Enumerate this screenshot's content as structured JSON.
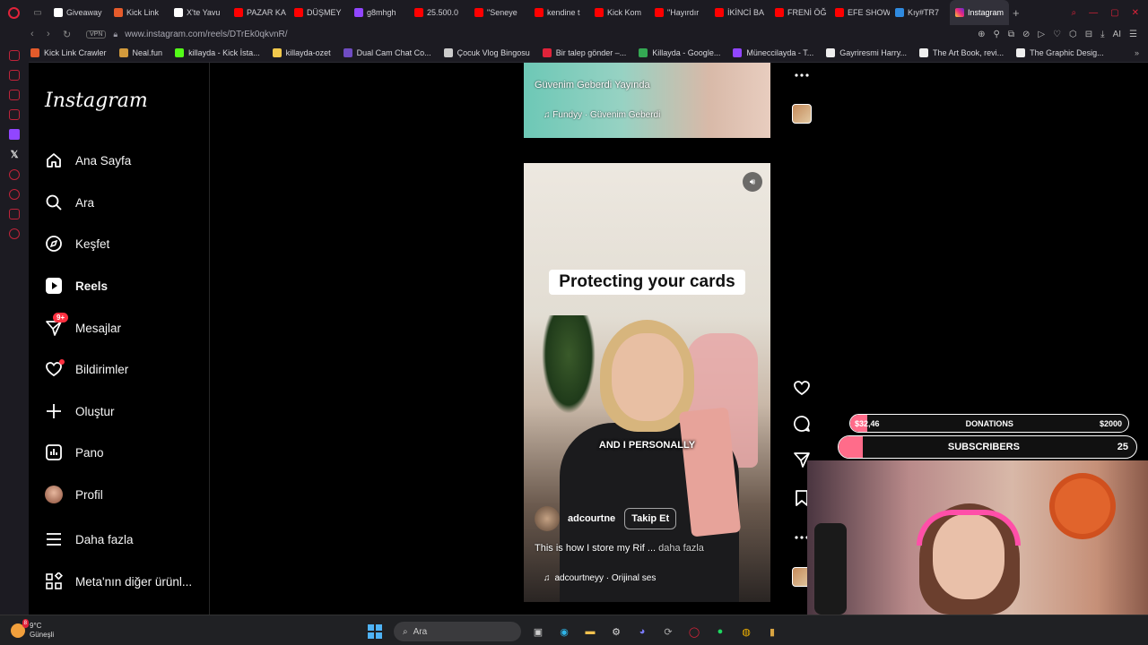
{
  "browser": {
    "tabs": [
      {
        "label": "Giveaway",
        "color": "#ffffff"
      },
      {
        "label": "Kick Link",
        "color": "#e55b2b"
      },
      {
        "label": "X'te Yavu",
        "color": "#ffffff"
      },
      {
        "label": "PAZAR KA",
        "color": "#ff0000"
      },
      {
        "label": "DÜŞMEY",
        "color": "#ff0000"
      },
      {
        "label": "g8mhgh",
        "color": "#9146ff"
      },
      {
        "label": "25.500.0",
        "color": "#ff0000"
      },
      {
        "label": "\"Seneye",
        "color": "#ff0000"
      },
      {
        "label": "kendine t",
        "color": "#ff0000"
      },
      {
        "label": "Kick Kom",
        "color": "#ff0000"
      },
      {
        "label": "\"Hayırdır",
        "color": "#ff0000"
      },
      {
        "label": "İKİNCİ BA",
        "color": "#ff0000"
      },
      {
        "label": "FRENİ ÖĞ",
        "color": "#ff0000"
      },
      {
        "label": "EFE SHOW",
        "color": "#ff0000"
      },
      {
        "label": "Kıy#TR7",
        "color": "#2f8ae0"
      }
    ],
    "active_tab": "Instagram",
    "url": "www.instagram.com/reels/DTrEk0qkvnR/",
    "vpn_label": "VPN",
    "ai_label": "AI"
  },
  "bookmarks": [
    {
      "label": "Kick Link Crawler",
      "color": "#e55b2b"
    },
    {
      "label": "Neal.fun",
      "color": "#d29a3c"
    },
    {
      "label": "killayda - Kick İsta...",
      "color": "#53fc18"
    },
    {
      "label": "killayda-ozet",
      "color": "#f2c94c"
    },
    {
      "label": "Dual Cam Chat Co...",
      "color": "#6f4cc2"
    },
    {
      "label": "Çocuk Vlog Bingosu",
      "color": "#cccccc"
    },
    {
      "label": "Bir talep gönder –...",
      "color": "#e0233a"
    },
    {
      "label": "Killayda - Google...",
      "color": "#34a853"
    },
    {
      "label": "Müneccilayda - T...",
      "color": "#9146ff"
    },
    {
      "label": "Gayriresmi Harry...",
      "color": "#eeeeee"
    },
    {
      "label": "The Art Book, revi...",
      "color": "#eeeeee"
    },
    {
      "label": "The Graphic Desig...",
      "color": "#eeeeee"
    }
  ],
  "instagram": {
    "logo": "Instagram",
    "nav": [
      {
        "label": "Ana Sayfa",
        "icon": "home-icon"
      },
      {
        "label": "Ara",
        "icon": "search-icon"
      },
      {
        "label": "Keşfet",
        "icon": "compass-icon"
      },
      {
        "label": "Reels",
        "icon": "reels-icon"
      },
      {
        "label": "Mesajlar",
        "icon": "messages-icon",
        "badge": "9+"
      },
      {
        "label": "Bildirimler",
        "icon": "heart-icon"
      },
      {
        "label": "Oluştur",
        "icon": "plus-icon"
      },
      {
        "label": "Pano",
        "icon": "dashboard-icon"
      },
      {
        "label": "Profil",
        "icon": "avatar"
      },
      {
        "label": "Daha fazla",
        "icon": "menu-icon"
      },
      {
        "label": "Meta'nın diğer ürünl...",
        "icon": "meta-apps-icon"
      }
    ],
    "prev_reel": {
      "caption": "Güvenim Geberdi Yayında",
      "music": "Fundyy · Güvenim Geberdi"
    },
    "reel": {
      "overlay_title": "Protecting your cards",
      "subtitle": "AND I PERSONALLY",
      "username": "adcourtne",
      "follow_label": "Takip Et",
      "description": "This is how I store my Rif ...",
      "more_label": "daha fazla",
      "music": "adcourtneyy · Orijinal ses"
    }
  },
  "stream_overlay": {
    "donation_current": "$32,46",
    "donation_label": "DONATIONS",
    "donation_goal": "$2000",
    "donation_progress": 0.06,
    "subs_current": "2",
    "subs_label": "SUBSCRIBERS",
    "subs_goal": "25",
    "subs_progress": 0.08
  },
  "taskbar": {
    "temperature": "9°C",
    "weather": "Güneşli",
    "weather_badge": "8",
    "search_placeholder": "Ara"
  }
}
